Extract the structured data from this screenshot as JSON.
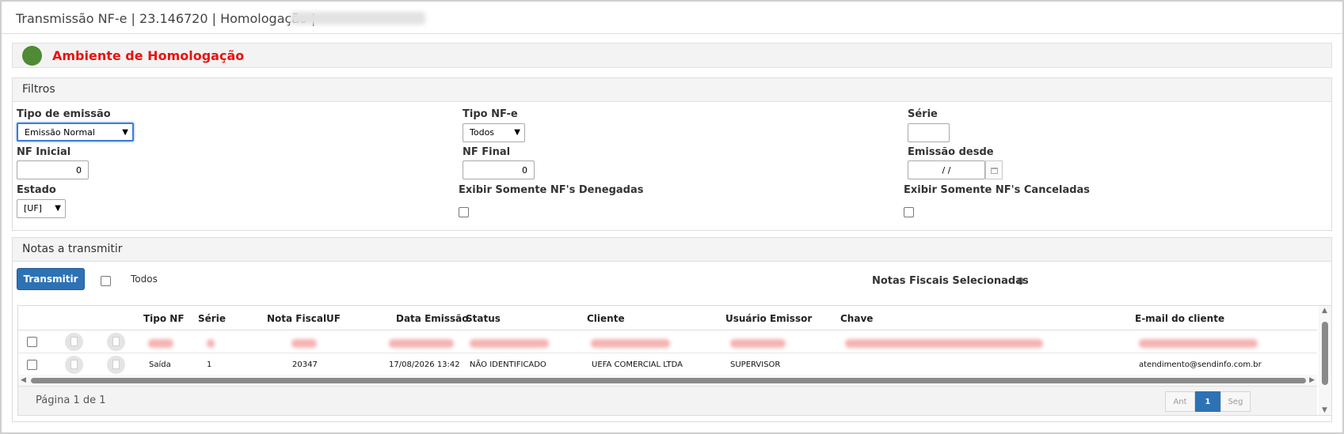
{
  "window": {
    "title": "Transmissão NF-e | 23.146720 | Homologação |"
  },
  "environment": {
    "label": "Ambiente de Homologação",
    "indicator_color": "#4f8a34",
    "label_color": "#e8130f"
  },
  "filters": {
    "title": "Filtros",
    "tipo_emissao": {
      "label": "Tipo de emissão",
      "value": "Emissão Normal"
    },
    "tipo_nfe": {
      "label": "Tipo NF-e",
      "value": "Todos"
    },
    "serie": {
      "label": "Série",
      "value": ""
    },
    "nf_inicial": {
      "label": "NF Inicial",
      "value": "0"
    },
    "nf_final": {
      "label": "NF Final",
      "value": "0"
    },
    "emissao_desde": {
      "label": "Emissão desde",
      "value": "/ /"
    },
    "estado": {
      "label": "Estado",
      "value": "[UF]"
    },
    "somente_denegadas": {
      "label": "Exibir Somente NF's Denegadas",
      "checked": false
    },
    "somente_canceladas": {
      "label": "Exibir Somente NF's Canceladas",
      "checked": false
    }
  },
  "notes": {
    "title": "Notas a transmitir",
    "transmit_button": "Transmitir",
    "todos_label": "Todos",
    "selected_label": "Notas Fiscais Selecionadas",
    "selected_count": "0",
    "columns": [
      "Tipo NF",
      "Série",
      "Nota Fiscal",
      "UF",
      "Data Emissão",
      "Status",
      "Cliente",
      "Usuário Emissor",
      "Chave",
      "E-mail do cliente"
    ],
    "rows": [
      {
        "tipo_nf": "Saída",
        "serie": "1",
        "nota_fiscal": "20347",
        "uf": "",
        "data_emissao": "17/08/2026 13:42",
        "status": "NÃO IDENTIFICADO",
        "cliente": "UEFA COMERCIAL LTDA",
        "usuario": "SUPERVISOR",
        "chave": "",
        "email": "atendimento@sendinfo.com.br"
      }
    ],
    "pagination": {
      "text": "Página 1 de 1",
      "prev": "Ant",
      "current": "1",
      "next": "Seg"
    },
    "accent_color": "#2d72b5"
  }
}
